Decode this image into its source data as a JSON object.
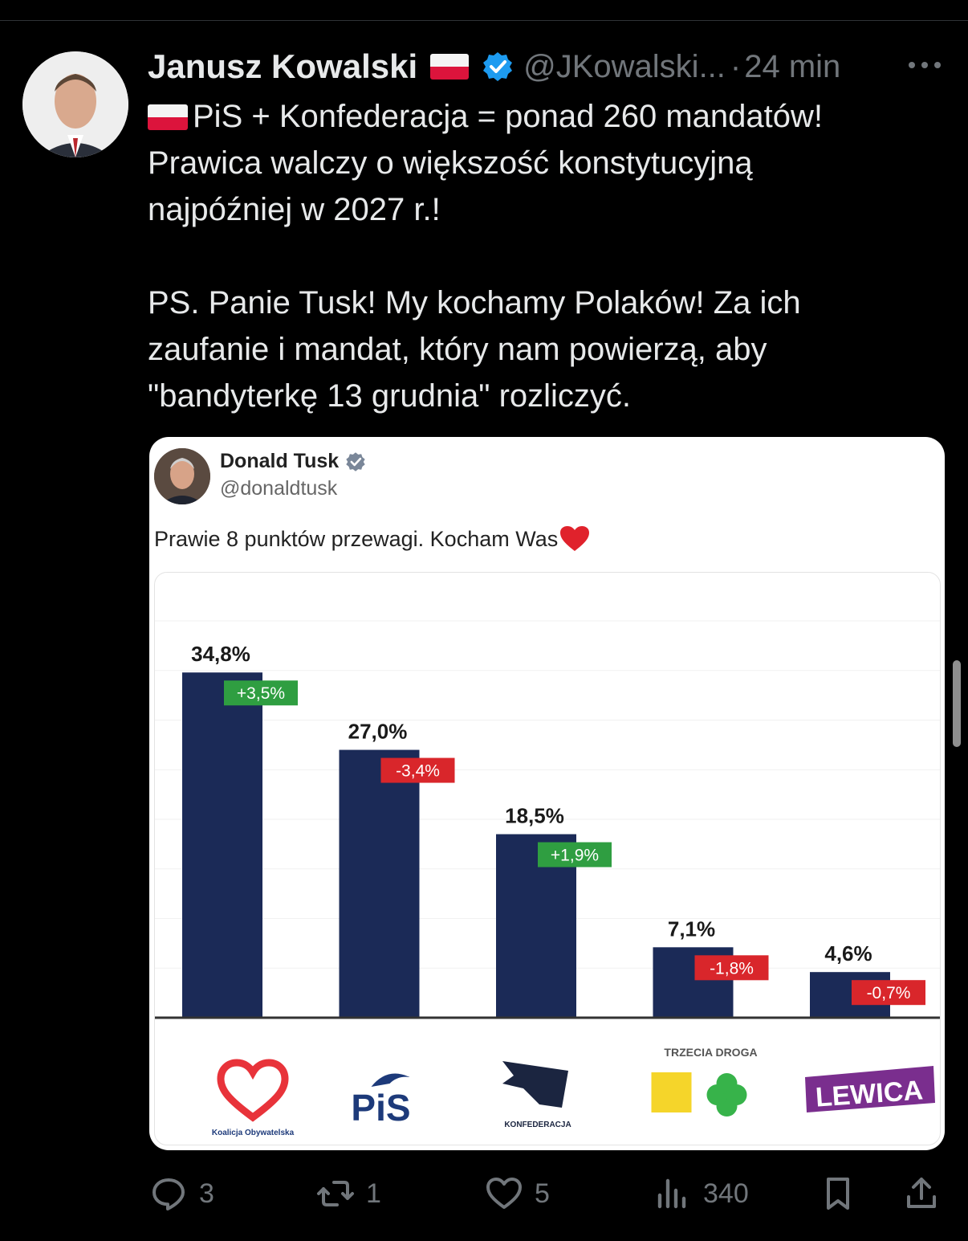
{
  "tweet": {
    "author_name": "Janusz Kowalski",
    "handle": "@JKowalski...",
    "separator": "·",
    "time": "24 min",
    "text_lines": [
      "PiS + Konfederacja = ponad 260 mandatów!",
      "Prawica walczy o większość konstytucyjną",
      "najpóźniej w 2027 r.!",
      "PS. Panie Tusk! My kochamy Polaków! Za ich",
      "zaufanie i mandat, który nam powierzą, aby",
      "\"bandyterkę 13 grudnia\" rozliczyć."
    ]
  },
  "embedded": {
    "author_name": "Donald Tusk",
    "handle": "@donaldtusk",
    "text": "Prawie 8 punktów przewagi. Kocham Was"
  },
  "chart_data": {
    "type": "bar",
    "categories": [
      "Koalicja Obywatelska",
      "PiS",
      "Konfederacja",
      "Trzecia Droga",
      "Lewica"
    ],
    "values": [
      34.8,
      27.0,
      18.5,
      7.1,
      4.6
    ],
    "value_labels": [
      "34,8%",
      "27,0%",
      "18,5%",
      "7,1%",
      "4,6%"
    ],
    "changes": [
      "+3,5%",
      "-3,4%",
      "+1,9%",
      "-1,8%",
      "-0,7%"
    ],
    "logo_texts": [
      "Koalicja Obywatelska",
      "PiS",
      "KONFEDERACJA",
      "TRZECIA DROGA",
      "LEWICA"
    ],
    "colors": {
      "bar": "#1b2a57",
      "positive": "#2f9e41",
      "negative": "#d9262b",
      "ko": "#e8333a",
      "pis": "#1d3a7a",
      "trzecia_yellow": "#f5d52a",
      "trzecia_green": "#37b34a",
      "lewica": "#7a2e8e"
    },
    "ylim": [
      0,
      40
    ]
  },
  "actions": {
    "replies": "3",
    "reposts": "1",
    "likes": "5",
    "views": "340"
  },
  "icons": [
    "verified-icon",
    "more-icon",
    "reply-icon",
    "repost-icon",
    "like-icon",
    "views-icon",
    "bookmark-icon",
    "share-icon",
    "heart-emoji-icon",
    "poland-flag-icon"
  ]
}
